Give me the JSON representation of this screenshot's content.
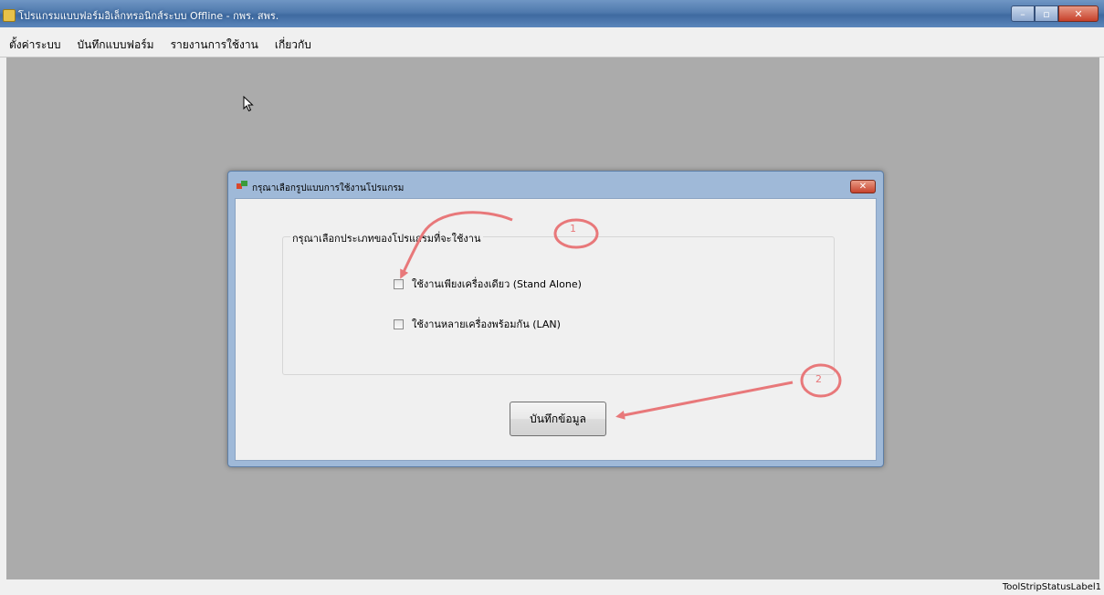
{
  "window": {
    "title": "โปรแกรมแบบฟอร์มอิเล็กทรอนิกส์ระบบ Offline - กพร. สพร.",
    "minimize_label": "–",
    "maximize_label": "▫",
    "close_label": "✕"
  },
  "menu": {
    "items": [
      {
        "label": "ตั้งค่าระบบ"
      },
      {
        "label": "บันทึกแบบฟอร์ม"
      },
      {
        "label": "รายงานการใช้งาน"
      },
      {
        "label": "เกี่ยวกับ"
      }
    ]
  },
  "dialog": {
    "title": "กรุณาเลือกรูปแบบการใช้งานโปรแกรม",
    "close_label": "✕",
    "group_label": "กรุณาเลือกประเภทของโปรแกรมที่จะใช้งาน",
    "options": [
      {
        "label": "ใช้งานเพียงเครื่องเดียว (Stand Alone)",
        "checked": false
      },
      {
        "label": "ใช้งานหลายเครื่องพร้อมกัน (LAN)",
        "checked": false
      }
    ],
    "save_button": "บันทึกข้อมูล"
  },
  "annotations": {
    "marker_1": "1",
    "marker_2": "2",
    "color": "#e8787a"
  },
  "statusbar": {
    "label": "ToolStripStatusLabel1"
  }
}
